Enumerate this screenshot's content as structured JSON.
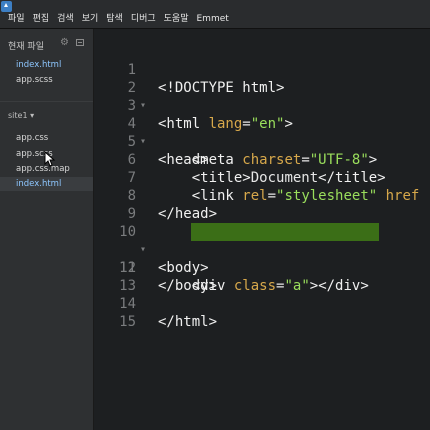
{
  "menu": [
    "파일",
    "편집",
    "검색",
    "보기",
    "탐색",
    "디버그",
    "도움말",
    "Emmet"
  ],
  "sidebar": {
    "header": "현재 파일",
    "working_files": [
      "index.html",
      "app.scss"
    ],
    "project": "site1 ▾",
    "tree": [
      "app.css",
      "app.scss",
      "app.css.map",
      "index.html"
    ]
  },
  "editor": {
    "lines": [
      {
        "n": "1",
        "fold": "",
        "code": "<!DOCTYPE html>"
      },
      {
        "n": "2",
        "fold": "▾",
        "code": "<html lang=\"en\">"
      },
      {
        "n": "3",
        "fold": "",
        "code": ""
      },
      {
        "n": "4",
        "fold": "▾",
        "code": "<head>"
      },
      {
        "n": "5",
        "fold": "",
        "code": "    <meta charset=\"UTF-8\">"
      },
      {
        "n": "6",
        "fold": "",
        "code": "    <title>Document</title>"
      },
      {
        "n": "7",
        "fold": "",
        "code": "    <link rel=\"stylesheet\" href"
      },
      {
        "n": "8",
        "fold": "",
        "code": "</head>"
      },
      {
        "n": "9",
        "fold": "",
        "code": ""
      },
      {
        "n": "10",
        "fold": "▾",
        "code": "<body>"
      },
      {
        "n": "11",
        "fold": "",
        "code": "    <div class=\"a\"></div>"
      },
      {
        "n": "12",
        "fold": "",
        "code": "</body>"
      },
      {
        "n": "13",
        "fold": "",
        "code": ""
      },
      {
        "n": "14",
        "fold": "",
        "code": "</html>"
      },
      {
        "n": "15",
        "fold": "",
        "code": ""
      }
    ],
    "highlighted_line": "11"
  },
  "colors": {
    "tag": "#4fc1ff",
    "attr": "#d7a84b",
    "string": "#9ade5c",
    "highlight": "#3b6e17"
  }
}
